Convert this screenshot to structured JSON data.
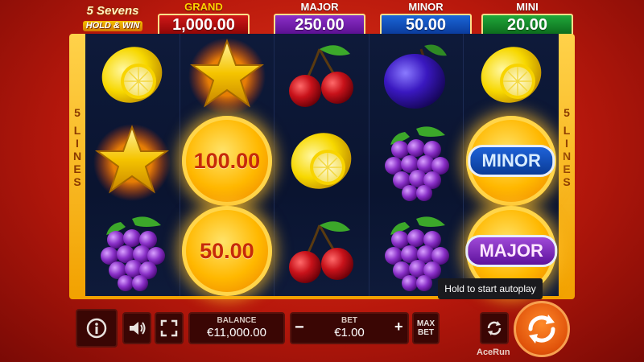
{
  "game": {
    "title_line1": "5 Sevens",
    "title_line2": "HOLD & WIN",
    "lines_label_left": [
      "5",
      "L",
      "I",
      "N",
      "E",
      "S"
    ],
    "lines_label_right": [
      "5",
      "L",
      "I",
      "N",
      "E",
      "S"
    ]
  },
  "jackpots": [
    {
      "name": "GRAND",
      "value": "1,000.00",
      "color": "#d01818"
    },
    {
      "name": "MAJOR",
      "value": "250.00",
      "color": "#8c2fc8"
    },
    {
      "name": "MINOR",
      "value": "50.00",
      "color": "#1a66d8"
    },
    {
      "name": "MINI",
      "value": "20.00",
      "color": "#20a83a"
    }
  ],
  "reels": [
    [
      "lemon-icon",
      "star-icon",
      "cherry-icon",
      "plum-icon",
      "lemon-icon"
    ],
    [
      "star-icon",
      "coin",
      "lemon-icon",
      "grapes-icon",
      "coin"
    ],
    [
      "grapes-icon",
      "coin",
      "cherry-icon",
      "grapes-icon",
      "coin"
    ]
  ],
  "coins": {
    "r2c2": "100.00",
    "r3c2": "50.00",
    "r2c5": "MINOR",
    "r3c5": "MAJOR"
  },
  "controls": {
    "balance_label": "BALANCE",
    "balance_value": "€11,000.00",
    "bet_label": "BET",
    "bet_value": "€1.00",
    "bet_minus": "−",
    "bet_plus": "+",
    "max_bet_line1": "MAX",
    "max_bet_line2": "BET",
    "tooltip": "Hold to start autoplay",
    "brand": "AceRun"
  },
  "icons": {
    "info": "info-icon",
    "sound": "speaker-icon",
    "fullscreen": "fullscreen-icon",
    "autoplay": "autoplay-icon",
    "spin": "spin-icon"
  }
}
